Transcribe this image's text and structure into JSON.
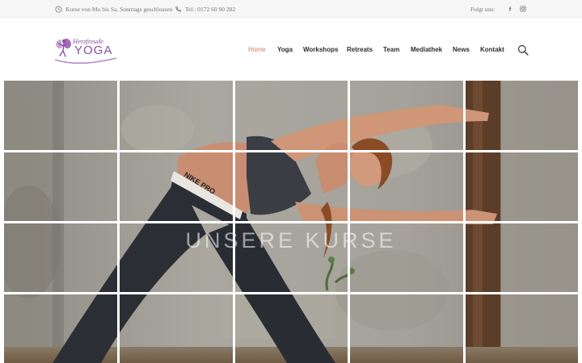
{
  "topbar": {
    "hours_text": "Kurse von Mo bis Sa, Sonntags geschlossen",
    "hours_icon": "clock-icon",
    "phone_text": "Tel.: 0172 60 90 282",
    "phone_icon": "phone-icon",
    "follow_label": "Folgt uns:",
    "facebook_glyph": "f",
    "social_icons": [
      "facebook-icon",
      "instagram-icon"
    ]
  },
  "logo": {
    "top_text": "Herzfreude",
    "main_text": "YOGA"
  },
  "nav": {
    "items": [
      {
        "label": "Home",
        "active": true
      },
      {
        "label": "Yoga",
        "active": false
      },
      {
        "label": "Workshops",
        "active": false
      },
      {
        "label": "Retreats",
        "active": false
      },
      {
        "label": "Team",
        "active": false
      },
      {
        "label": "Mediathek",
        "active": false
      },
      {
        "label": "News",
        "active": false
      },
      {
        "label": "Kontakt",
        "active": false
      }
    ],
    "search_icon": "search-icon"
  },
  "hero": {
    "title": "UNSERE KURSE",
    "shirt_text": "NIKE PRO"
  },
  "colors": {
    "brand_purple": "#8a4fa2",
    "nav_active": "#d67a6b",
    "topbar_bg": "#f6f6f6"
  }
}
